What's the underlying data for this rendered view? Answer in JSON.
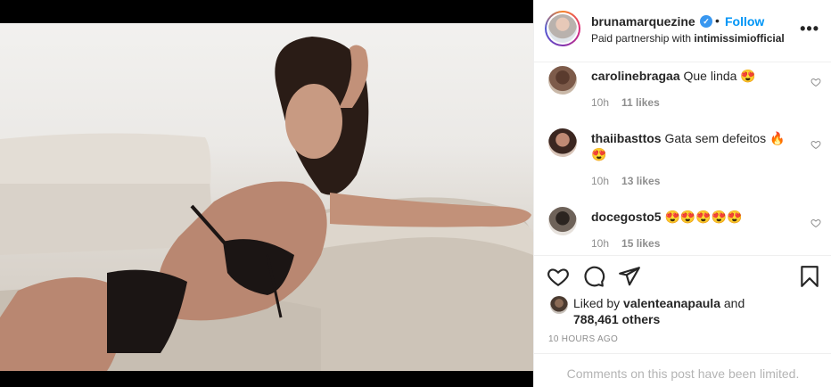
{
  "post": {
    "username": "brunamarquezine",
    "follow_label": "Follow",
    "dot": "•",
    "verified_mark": "✓",
    "partnership_prefix": "Paid partnership with ",
    "partner_brand": "intimissimiofficial",
    "more_label": "•••"
  },
  "comments": [
    {
      "user": "carolinebragaa",
      "text": "Que linda 😍",
      "age": "10h",
      "likes": "11 likes"
    },
    {
      "user": "thaiibasttos",
      "text": "Gata sem defeitos 🔥 😍",
      "age": "10h",
      "likes": "13 likes"
    },
    {
      "user": "docegosto5",
      "text": "😍😍😍😍😍",
      "age": "10h",
      "likes": "15 likes"
    }
  ],
  "likes": {
    "prefix": "Liked by ",
    "user": "valenteanapaula",
    "joiner": " and",
    "count": "788,461 others"
  },
  "timestamp": "10 HOURS AGO",
  "limited_notice": "Comments on this post have been limited.",
  "colors": {
    "accent": "#0095f6",
    "verified": "#3897f0",
    "muted": "#8e8e8e"
  },
  "icons": [
    "heart-icon",
    "comment-icon",
    "share-icon",
    "bookmark-icon",
    "more-icon",
    "verified-icon"
  ]
}
